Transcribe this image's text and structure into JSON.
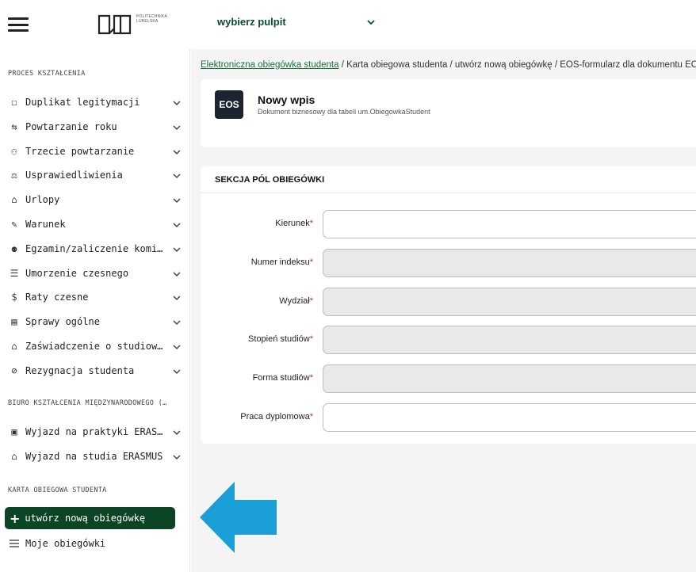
{
  "header": {
    "logo_text": "POLITECHNIKA\nLUBELSKA",
    "pulpit_label": "wybierz pulpit"
  },
  "sidebar": {
    "section1_title": "PROCES KSZTAŁCENIA",
    "items": [
      {
        "label": "Duplikat legitymacji",
        "icon": "id-card-icon"
      },
      {
        "label": "Powtarzanie roku",
        "icon": "repeat-icon"
      },
      {
        "label": "Trzecie powtarzanie",
        "icon": "people-icon"
      },
      {
        "label": "Usprawiedliwienia",
        "icon": "scale-icon"
      },
      {
        "label": "Urlopy",
        "icon": "home-icon"
      },
      {
        "label": "Warunek",
        "icon": "edit-icon"
      },
      {
        "label": "Egzamin/zaliczenie komis…",
        "icon": "user-check-icon"
      },
      {
        "label": "Umorzenie czesnego",
        "icon": "coins-icon"
      },
      {
        "label": "Raty czesne",
        "icon": "hand-coin-icon"
      },
      {
        "label": "Sprawy ogólne",
        "icon": "folder-icon"
      },
      {
        "label": "Zaświadczenie o studiowa…",
        "icon": "graduation-cap-icon"
      },
      {
        "label": "Rezygnacja studenta",
        "icon": "ban-icon"
      }
    ],
    "section2_title": "BIURO KSZTAŁCENIA MIĘDZYNARODOWEGO (…",
    "items2": [
      {
        "label": "Wyjazd na praktyki ERASM…",
        "icon": "briefcase-icon"
      },
      {
        "label": "Wyjazd na studia ERASMUS",
        "icon": "graduation-cap-icon"
      }
    ],
    "section3_title": "KARTA OBIEGOWA STUDENTA",
    "active_item": "utwórz nową obiegówkę",
    "last_item": "Moje obiegówki"
  },
  "breadcrumb": {
    "link": "Elektroniczna obiegówka studenta",
    "rest": " / Karta obiegowa studenta / utwórz nową obiegówkę / EOS-formularz dla dokumentu EOS"
  },
  "doc_header": {
    "badge": "EOS",
    "title": "Nowy wpis",
    "subtitle": "Dokument biznesowy dla tabeli um.ObiegowkaStudent"
  },
  "form": {
    "section_title": "SEKCJA PÓL OBIEGÓWKI",
    "fields": [
      {
        "label": "Kierunek",
        "value": "",
        "disabled": false
      },
      {
        "label": "Numer indeksu",
        "value": "",
        "disabled": true
      },
      {
        "label": "Wydział",
        "value": "",
        "disabled": true
      },
      {
        "label": "Stopień studiów",
        "value": "",
        "disabled": true
      },
      {
        "label": "Forma studiów",
        "value": "",
        "disabled": true
      },
      {
        "label": "Praca dyplomowa",
        "value": "",
        "disabled": false
      }
    ]
  },
  "colors": {
    "accent": "#0b4526",
    "link": "#1f6e43",
    "arrow": "#1a9fd8",
    "required": "#c62828"
  }
}
